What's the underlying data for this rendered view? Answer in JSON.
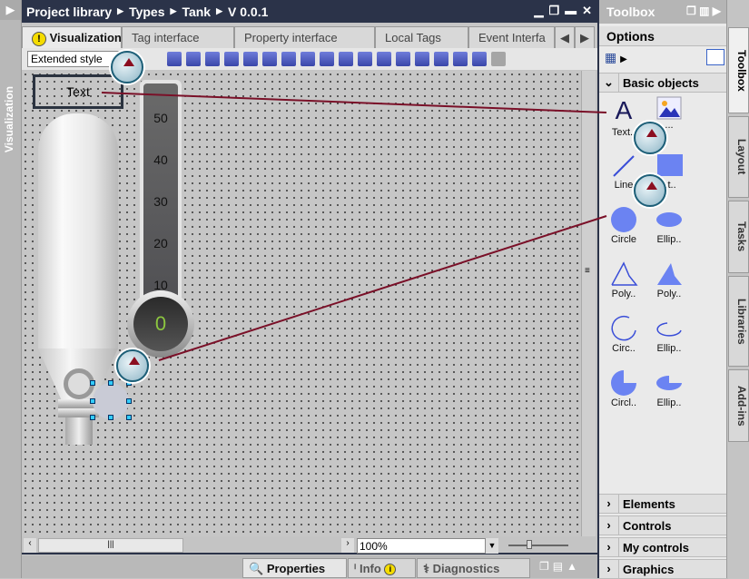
{
  "left_panel": {
    "label": "Visualization"
  },
  "titlebar": {
    "breadcrumb": [
      "Project library",
      "Types",
      "Tank",
      "V 0.0.1"
    ]
  },
  "tabs": [
    {
      "label": "Visualization"
    },
    {
      "label": "Tag interface"
    },
    {
      "label": "Property interface"
    },
    {
      "label": "Local Tags"
    },
    {
      "label": "Event Interfa"
    }
  ],
  "toolbar": {
    "style_select": "Extended style"
  },
  "canvas": {
    "text_object": "Text",
    "scale_labels": [
      "50",
      "40",
      "30",
      "20",
      "10"
    ],
    "gauge_value": "0"
  },
  "zoom": {
    "value": "100%"
  },
  "bottom_tabs": [
    {
      "label": "Properties"
    },
    {
      "label": "Info"
    },
    {
      "label": "Diagnostics"
    }
  ],
  "toolbox": {
    "title": "Toolbox",
    "options": "Options",
    "basic_objects": "Basic objects",
    "items": [
      {
        "label": "Text.."
      },
      {
        "label": "..."
      },
      {
        "label": "Line"
      },
      {
        "label": "..t.."
      },
      {
        "label": "Circle"
      },
      {
        "label": "Ellip.."
      },
      {
        "label": "Poly.."
      },
      {
        "label": "Poly.."
      },
      {
        "label": "Circ.."
      },
      {
        "label": "Ellip.."
      },
      {
        "label": "Circl.."
      },
      {
        "label": "Ellip.."
      }
    ],
    "sections": [
      "Elements",
      "Controls",
      "My controls",
      "Graphics"
    ]
  },
  "right_tabs": [
    "Toolbox",
    "Layout",
    "Tasks",
    "Libraries",
    "Add-ins"
  ]
}
